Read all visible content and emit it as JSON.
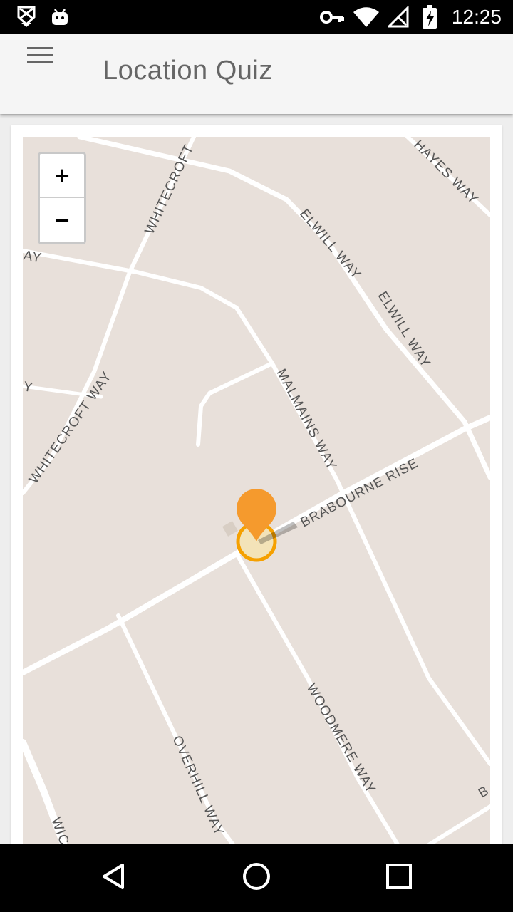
{
  "status_bar": {
    "time": "12:25",
    "icons": [
      "notification-x-icon",
      "android-icon",
      "vpn-key-icon",
      "wifi-icon",
      "no-signal-icon",
      "battery-charging-icon"
    ]
  },
  "app_bar": {
    "title": "Location Quiz",
    "menu_icon": "hamburger-menu-icon"
  },
  "map": {
    "zoom_in_label": "+",
    "zoom_out_label": "−",
    "colors": {
      "land": "#e8e0da",
      "road": "#ffffff",
      "marker": "#f59a2d",
      "location_ring": "#f5a000"
    },
    "streets": {
      "hayes": "HAYES WAY",
      "elwill_1": "ELWILL WAY",
      "elwill_2": "ELWILL WAY",
      "whitecroft_top": "WHITECROFT",
      "whitecroft_way": "WHITECROFT WAY",
      "malmains": "MALMAINS WAY",
      "brabourne": "BRABOURNE RISE",
      "woodmere": "WOODMERE WAY",
      "overhill": "OVERHILL WAY",
      "partial_ay": "AY",
      "partial_y": "Y",
      "partial_wic": "WIC",
      "partial_b": "B"
    }
  },
  "nav_bar": {
    "back_icon": "back-triangle-icon",
    "home_icon": "home-circle-icon",
    "recents_icon": "recents-square-icon"
  }
}
